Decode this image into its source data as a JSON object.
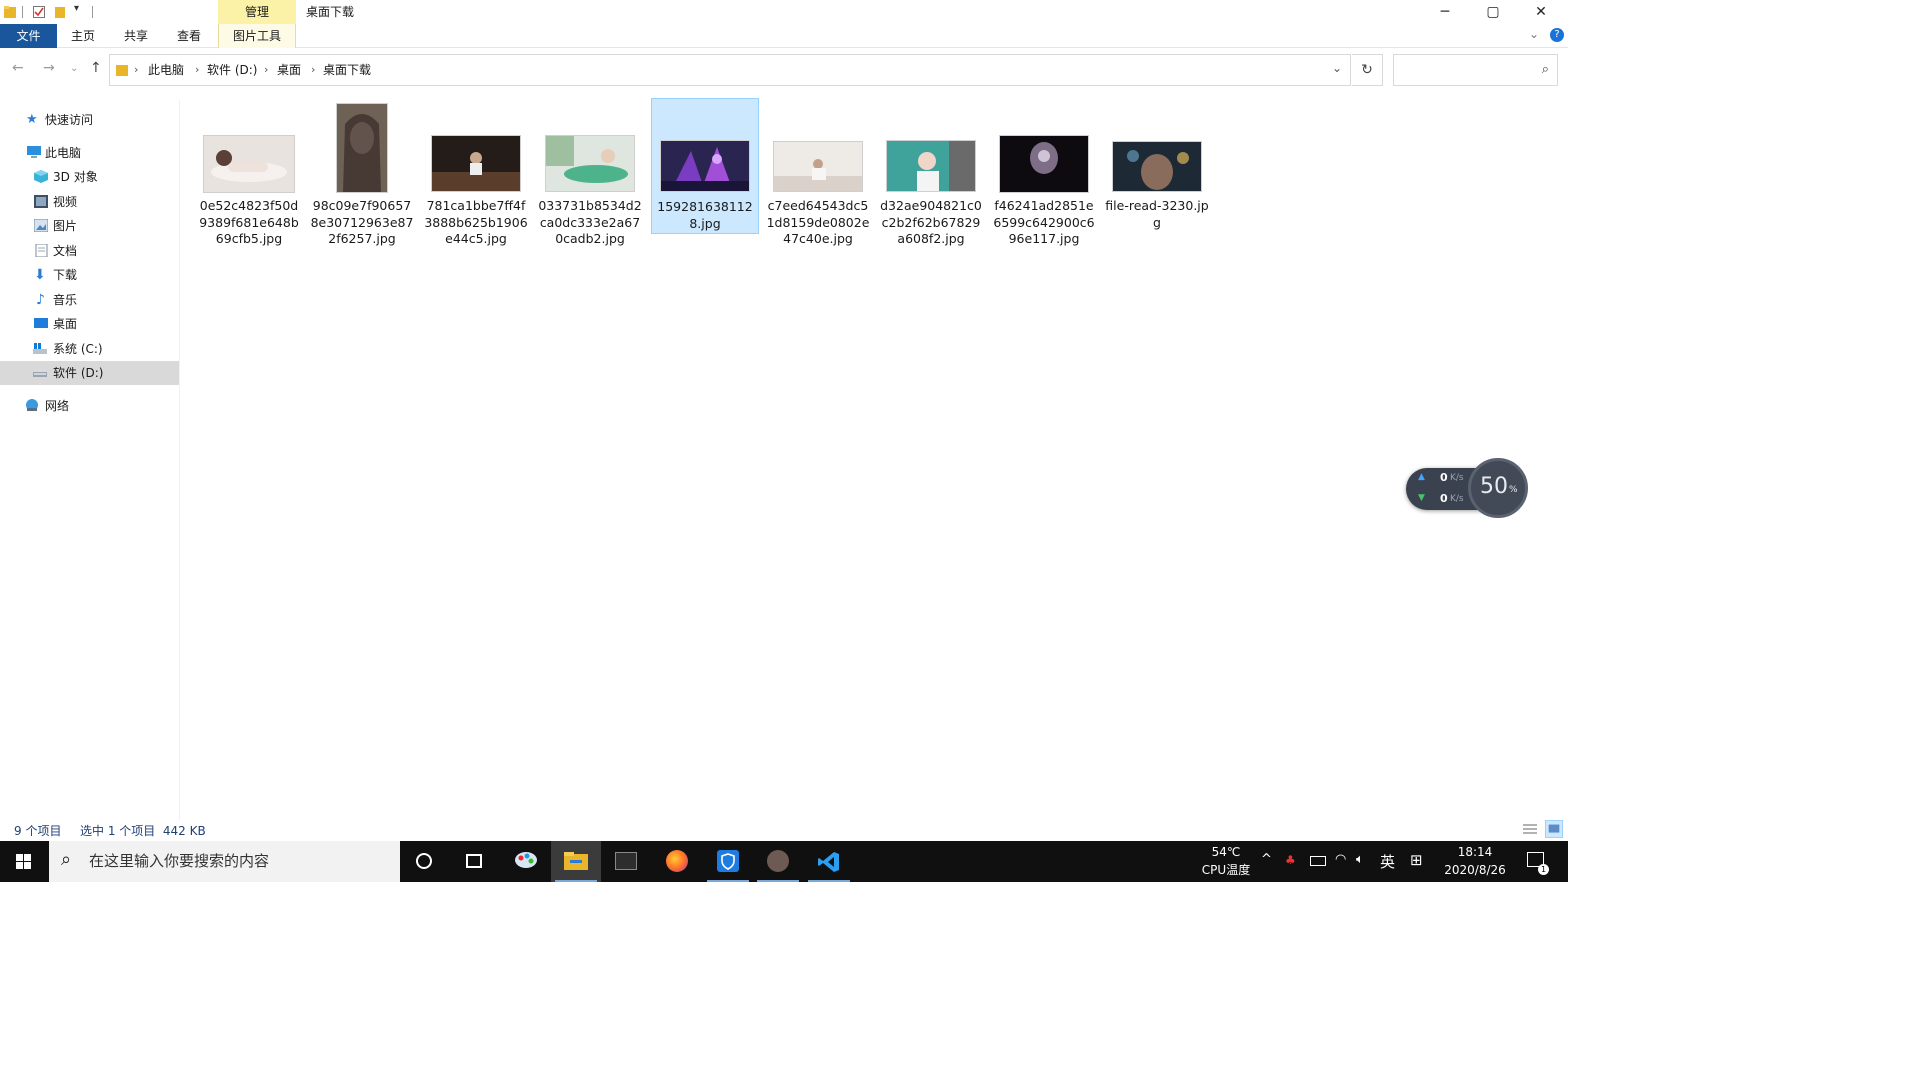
{
  "window": {
    "title": "桌面下载",
    "ribbon_context_tab": "管理",
    "ribbon_tabs": [
      "文件",
      "主页",
      "共享",
      "查看",
      "图片工具"
    ],
    "controls": {
      "minimize": "─",
      "maximize": "▢",
      "close": "✕"
    }
  },
  "address": {
    "breadcrumbs": [
      "此电脑",
      "软件 (D:)",
      "桌面",
      "桌面下载"
    ],
    "search_placeholder": ""
  },
  "nav": {
    "items": [
      {
        "label": "快速访问",
        "icon": "star-icon"
      },
      {
        "label": "此电脑",
        "icon": "computer-icon"
      },
      {
        "label": "3D 对象",
        "icon": "cube-3d-icon"
      },
      {
        "label": "视频",
        "icon": "video-icon"
      },
      {
        "label": "图片",
        "icon": "pictures-icon"
      },
      {
        "label": "文档",
        "icon": "document-icon"
      },
      {
        "label": "下载",
        "icon": "download-icon"
      },
      {
        "label": "音乐",
        "icon": "music-icon"
      },
      {
        "label": "桌面",
        "icon": "desktop-icon"
      },
      {
        "label": "系统 (C:)",
        "icon": "drive-c-icon"
      },
      {
        "label": "软件 (D:)",
        "icon": "drive-d-icon"
      },
      {
        "label": "网络",
        "icon": "network-icon"
      }
    ],
    "selected": "软件 (D:)"
  },
  "files": [
    {
      "name": "0e52c4823f50d9389f681e648b69cfb5.jpg",
      "selected": false
    },
    {
      "name": "98c09e7f906578e30712963e872f6257.jpg",
      "selected": false
    },
    {
      "name": "781ca1bbe7ff4f3888b625b1906e44c5.jpg",
      "selected": false
    },
    {
      "name": "033731b8534d2ca0dc333e2a670cadb2.jpg",
      "selected": false
    },
    {
      "name": "1592816381128.jpg",
      "selected": true
    },
    {
      "name": "c7eed64543dc51d8159de0802e47c40e.jpg",
      "selected": false
    },
    {
      "name": "d32ae904821c0c2b2f62b67829a608f2.jpg",
      "selected": false
    },
    {
      "name": "f46241ad2851e6599c642900c696e117.jpg",
      "selected": false
    },
    {
      "name": "file-read-3230.jpg",
      "selected": false
    }
  ],
  "status": {
    "item_count": "9 个项目",
    "selection": "选中 1 个项目  442 KB"
  },
  "net_widget": {
    "up": "0",
    "down": "0",
    "unit": "K/s",
    "percent": "50",
    "percent_sign": "%"
  },
  "taskbar": {
    "search_text": "在这里输入你要搜索的内容",
    "cpu_temp": "54℃",
    "cpu_label": "CPU温度",
    "ime": "英",
    "time": "18:14",
    "date": "2020/8/26",
    "notification_count": "1"
  },
  "colors": {
    "file_tab": "#19569c",
    "manage_tab": "#fbf2a8",
    "selection_bg": "#cce8ff",
    "selection_border": "#99d1ff",
    "taskbar": "#101010",
    "status_text": "#1f3f75"
  }
}
